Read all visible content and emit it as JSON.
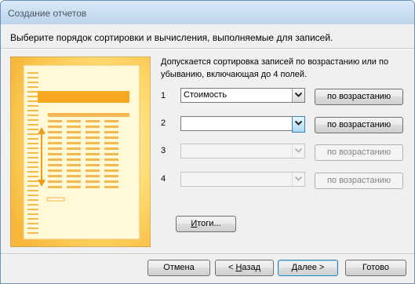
{
  "window": {
    "title": "Создание отчетов"
  },
  "header": {
    "instruction": "Выберите порядок сортировки и вычисления, выполняемые для записей."
  },
  "description": "Допускается сортировка записей по возрастанию или по убыванию, включающая до 4 полей.",
  "sort_rows": [
    {
      "number": "1",
      "field": "Стоимость",
      "order": "по возрастанию",
      "enabled": true
    },
    {
      "number": "2",
      "field": "",
      "order": "по возрастанию",
      "enabled": true
    },
    {
      "number": "3",
      "field": "",
      "order": "по возрастанию",
      "enabled": false
    },
    {
      "number": "4",
      "field": "",
      "order": "по возрастанию",
      "enabled": false
    }
  ],
  "summary_button": {
    "label": "Итоги...",
    "mnemonic": "И",
    "rest": "тоги..."
  },
  "footer": {
    "cancel": "Отмена",
    "back": {
      "prefix": "< ",
      "mnemonic": "Н",
      "rest": "азад"
    },
    "next": {
      "mnemonic": "Д",
      "rest": "алее >"
    },
    "finish": "Готово"
  },
  "colors": {
    "illustration_bg": "#ffe58a",
    "illustration_accent": "#f7a823",
    "focus_border": "#3c7fb1"
  }
}
